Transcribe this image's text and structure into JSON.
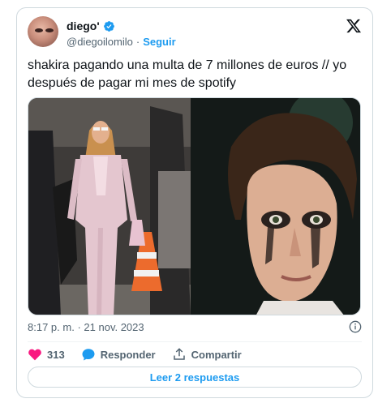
{
  "user": {
    "display_name": "diego'",
    "handle": "@diegoilomilo",
    "separator": "·",
    "follow_label": "Seguir"
  },
  "tweet": {
    "text": "shakira pagando una multa de 7 millones de euros // yo\ndespués de pagar mi mes de spotify",
    "time": "8:17 p. m.",
    "date_separator": "·",
    "date": "21 nov. 2023"
  },
  "actions": {
    "likes": "313",
    "reply_label": "Responder",
    "share_label": "Compartir"
  },
  "read_replies_label": "Leer 2 respuestas",
  "colors": {
    "accent": "#1d9bf0",
    "like": "#f91880",
    "text": "#0f1419",
    "muted": "#536471"
  },
  "icons": [
    "verified-badge-icon",
    "x-logo-icon",
    "info-icon",
    "heart-icon",
    "reply-icon",
    "share-icon"
  ]
}
